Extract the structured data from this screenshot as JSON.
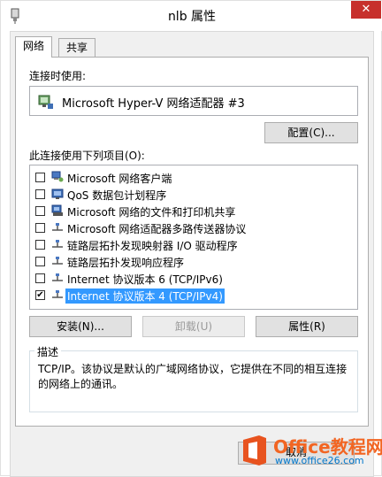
{
  "window": {
    "title": "nlb 属性",
    "close_glyph": "✕"
  },
  "tabs": [
    {
      "label": "网络"
    },
    {
      "label": "共享"
    }
  ],
  "connect_using": {
    "label": "连接时使用:",
    "adapter_name": "Microsoft Hyper-V 网络适配器 #3",
    "configure_label": "配置(C)..."
  },
  "items_section": {
    "label": "此连接使用下列项目(O):",
    "items": [
      {
        "label": "Microsoft 网络客户端",
        "checked": false,
        "icon": "network-client-icon"
      },
      {
        "label": "QoS 数据包计划程序",
        "checked": false,
        "icon": "qos-icon"
      },
      {
        "label": "Microsoft 网络的文件和打印机共享",
        "checked": false,
        "icon": "file-printer-share-icon"
      },
      {
        "label": "Microsoft 网络适配器多路传送器协议",
        "checked": false,
        "icon": "protocol-icon"
      },
      {
        "label": "链路层拓扑发现映射器 I/O 驱动程序",
        "checked": false,
        "icon": "protocol-icon"
      },
      {
        "label": "链路层拓扑发现响应程序",
        "checked": false,
        "icon": "protocol-icon"
      },
      {
        "label": "Internet 协议版本 6 (TCP/IPv6)",
        "checked": false,
        "icon": "protocol-icon"
      },
      {
        "label": "Internet 协议版本 4 (TCP/IPv4)",
        "checked": true,
        "icon": "protocol-icon",
        "selected": true
      }
    ]
  },
  "buttons": {
    "install": "安装(N)...",
    "uninstall": "卸载(U)",
    "properties": "属性(R)",
    "cancel": "取消"
  },
  "description": {
    "title": "描述",
    "text": "TCP/IP。该协议是默认的广域网络协议，它提供在不同的相互连接的网络上的通讯。"
  },
  "watermark": {
    "title": "Office教程网",
    "url": "www.office26.com"
  },
  "colors": {
    "selection": "#3399ff",
    "close_button": "#c7302c",
    "watermark_orange": "#f26522"
  }
}
